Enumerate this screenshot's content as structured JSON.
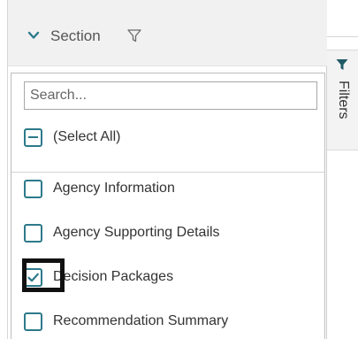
{
  "header": {
    "title": "Section"
  },
  "dropdown": {
    "search_placeholder": "Search...",
    "select_all_label": "(Select All)",
    "items": [
      {
        "label": "Agency Information",
        "checked": false
      },
      {
        "label": "Agency Supporting Details",
        "checked": false
      },
      {
        "label": "Decision Packages",
        "checked": true
      },
      {
        "label": "Recommendation Summary",
        "checked": false
      }
    ]
  },
  "side_tab": {
    "label": "Filters"
  },
  "colors": {
    "accent": "#2c7a8a",
    "header_bg": "#f1f1f1",
    "text": "#333333",
    "funnel_fill": "#1f5a66",
    "highlight": "#111111"
  },
  "icons": {
    "collapse": "chevron-down-icon",
    "header_filter": "filter-outline-icon",
    "tab_filter": "filter-filled-icon",
    "checked": "checkmark-icon"
  }
}
